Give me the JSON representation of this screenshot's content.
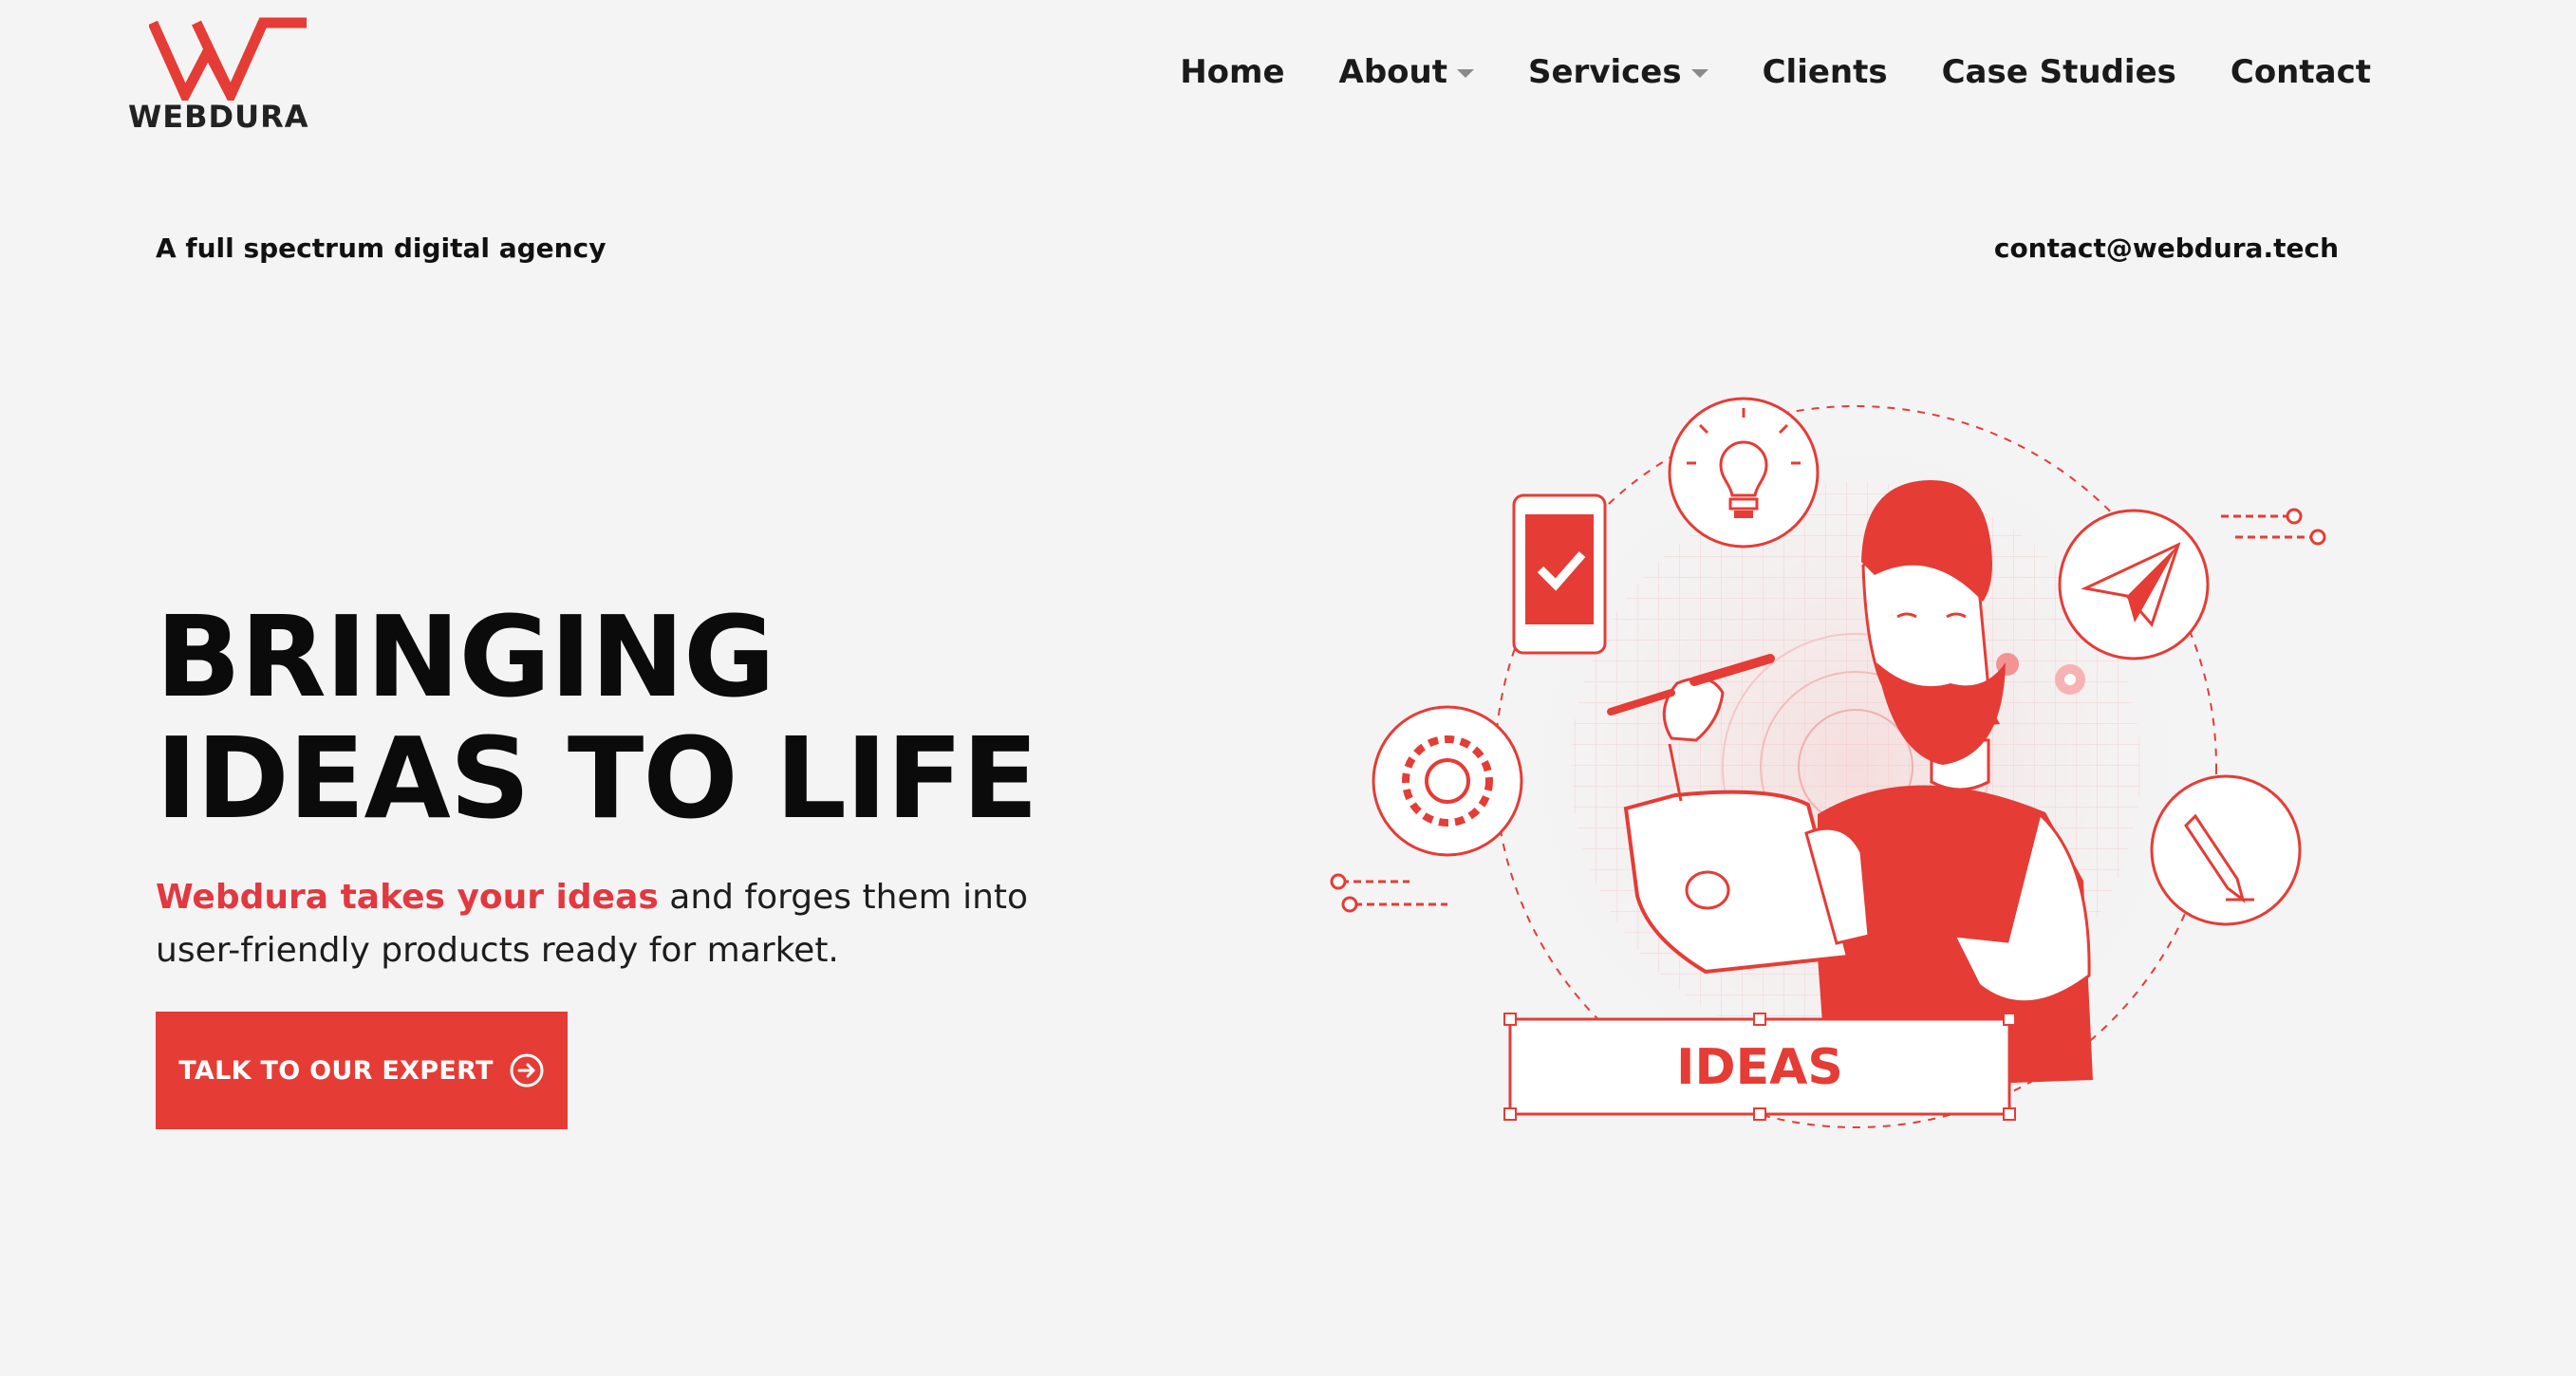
{
  "brand": {
    "name": "WEBDURA",
    "accent": "#e53c36"
  },
  "nav": {
    "items": [
      {
        "label": "Home",
        "dropdown": false
      },
      {
        "label": "About",
        "dropdown": true
      },
      {
        "label": "Services",
        "dropdown": true
      },
      {
        "label": "Clients",
        "dropdown": false
      },
      {
        "label": "Case Studies",
        "dropdown": false
      },
      {
        "label": "Contact",
        "dropdown": false
      }
    ]
  },
  "topbar": {
    "tagline": "A full spectrum digital agency",
    "email": "contact@webdura.tech"
  },
  "hero": {
    "headline_line1": "BRINGING",
    "headline_line2": "IDEAS TO LIFE",
    "sub_highlight": "Webdura takes your ideas",
    "sub_rest_line1": " and forges them into",
    "sub_line2": "user-friendly products ready for market.",
    "cta_label": "TALK TO OUR EXPERT",
    "cta_icon": "arrow-circle-right-icon"
  },
  "illustration": {
    "label": "IDEAS"
  }
}
